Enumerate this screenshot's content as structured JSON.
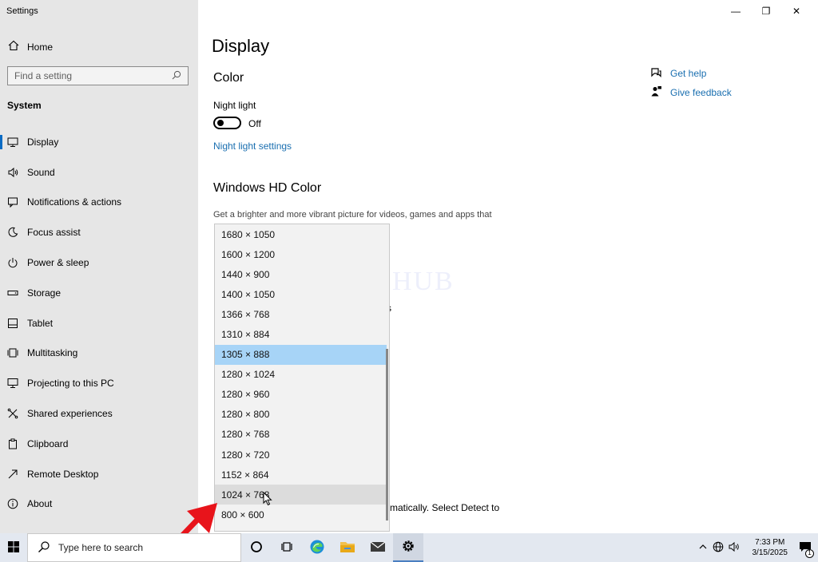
{
  "window": {
    "app_title": "Settings",
    "minimize": "—",
    "restore": "❐",
    "close": "✕"
  },
  "sidebar": {
    "home_label": "Home",
    "search_placeholder": "Find a setting",
    "section_label": "System",
    "items": [
      {
        "label": "Display",
        "icon": "monitor-icon"
      },
      {
        "label": "Sound",
        "icon": "speaker-icon"
      },
      {
        "label": "Notifications & actions",
        "icon": "notification-icon"
      },
      {
        "label": "Focus assist",
        "icon": "moon-icon"
      },
      {
        "label": "Power & sleep",
        "icon": "power-icon"
      },
      {
        "label": "Storage",
        "icon": "storage-icon"
      },
      {
        "label": "Tablet",
        "icon": "tablet-icon"
      },
      {
        "label": "Multitasking",
        "icon": "multitasking-icon"
      },
      {
        "label": "Projecting to this PC",
        "icon": "projector-icon"
      },
      {
        "label": "Shared experiences",
        "icon": "shared-icon"
      },
      {
        "label": "Clipboard",
        "icon": "clipboard-icon"
      },
      {
        "label": "Remote Desktop",
        "icon": "remote-icon"
      },
      {
        "label": "About",
        "icon": "info-icon"
      }
    ]
  },
  "main": {
    "title": "Display",
    "color_heading": "Color",
    "night_light_label": "Night light",
    "night_light_state": "Off",
    "night_light_link": "Night light settings",
    "hdr_heading": "Windows HD Color",
    "hdr_description": "Get a brighter and more vibrant picture for videos, games and apps that",
    "partial_s": "s",
    "partial_detect_text": "matically. Select Detect to",
    "help": {
      "get_help": "Get help",
      "give_feedback": "Give feedback"
    },
    "watermark": "IT Pros HUB"
  },
  "resolution_dropdown": {
    "options": [
      "1680 × 1050",
      "1600 × 1200",
      "1440 × 900",
      "1400 × 1050",
      "1366 × 768",
      "1310 × 884",
      "1305 × 888",
      "1280 × 1024",
      "1280 × 960",
      "1280 × 800",
      "1280 × 768",
      "1280 × 720",
      "1152 × 864",
      "1024 × 768",
      "800 × 600"
    ],
    "selected": "1305 × 888",
    "hovered": "1024 × 768"
  },
  "taskbar": {
    "search_placeholder": "Type here to search",
    "time": "7:33 PM",
    "date": "3/15/2025",
    "notification_count": "1"
  },
  "colors": {
    "accent": "#0a6bc4",
    "link": "#1a6fb0",
    "selected_option": "#a7d4f7",
    "arrow": "#e8141b"
  }
}
